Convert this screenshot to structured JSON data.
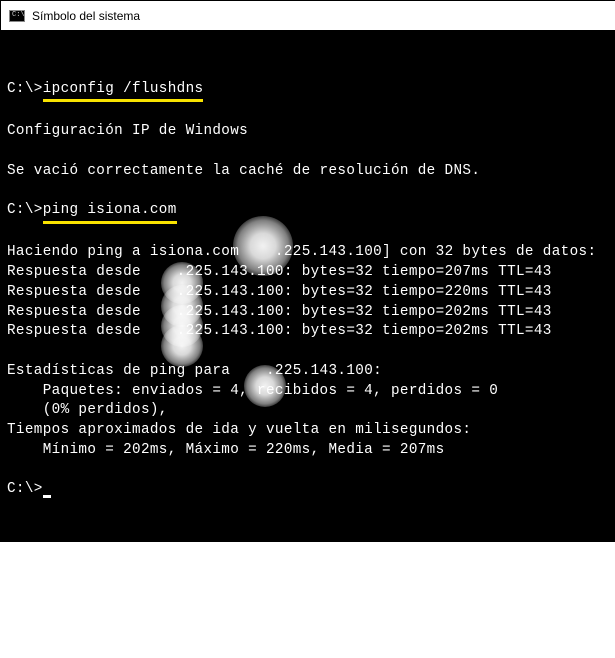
{
  "window": {
    "title": "Símbolo del sistema",
    "icon_text": "C:\\"
  },
  "terminal": {
    "prompt": "C:\\>",
    "cmd1": "ipconfig /flushdns",
    "blank": "",
    "config_header": "Configuración IP de Windows",
    "flush_result": "Se vació correctamente la caché de resolución de DNS.",
    "cmd2": "ping isiona.com",
    "ping_header_a": "Haciendo ping a isiona.com ",
    "ping_header_ip": ".225.143.100",
    "ping_header_b": "] con 32 bytes de datos:",
    "reply_prefix": "Respuesta desde ",
    "reply_ip": ".225.143.100:",
    "reply1_tail": " bytes=32 tiempo=207ms TTL=43",
    "reply2_tail": " bytes=32 tiempo=220ms TTL=43",
    "reply3_tail": " bytes=32 tiempo=202ms TTL=43",
    "reply4_tail": " bytes=32 tiempo=202ms TTL=43",
    "stats_header_a": "Estadísticas de ping para ",
    "stats_ip": ".225.143.100:",
    "packets": "    Paquetes: enviados = 4, recibidos = 4, perdidos = 0",
    "loss": "    (0% perdidos),",
    "rtt_header": "Tiempos aproximados de ida y vuelta en milisegundos:",
    "rtt_values": "    Mínimo = 202ms, Máximo = 220ms, Media = 207ms"
  }
}
